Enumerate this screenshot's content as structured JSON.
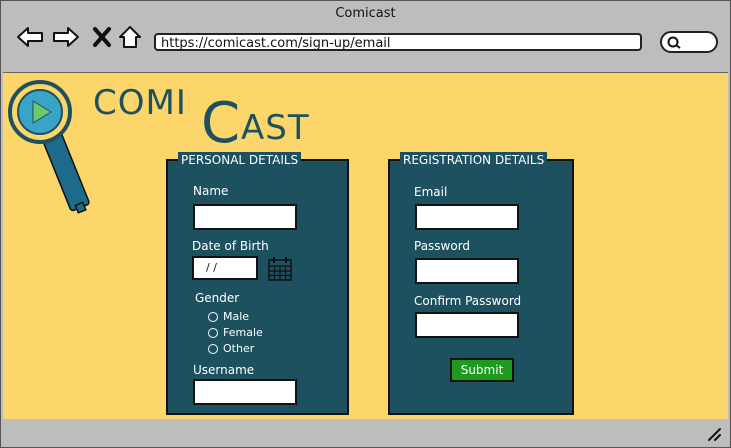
{
  "window": {
    "title": "Comicast"
  },
  "toolbar": {
    "back_icon": "arrow-left-icon",
    "forward_icon": "arrow-right-icon",
    "close_icon": "x-icon",
    "home_icon": "home-icon",
    "url": "https://comicast.com/sign-up/email",
    "search_icon": "search-icon"
  },
  "logo": {
    "part1": "COMI",
    "part2": "C",
    "part3": "AST"
  },
  "personal": {
    "title": "PERSONAL DETAILS",
    "name_label": "Name",
    "dob_label": "Date of Birth",
    "dob_value": "/ /",
    "gender_label": "Gender",
    "gender_options": [
      "Male",
      "Female",
      "Other"
    ],
    "username_label": "Username"
  },
  "registration": {
    "title": "REGISTRATION DETAILS",
    "email_label": "Email",
    "password_label": "Password",
    "confirm_label": "Confirm Password",
    "submit_label": "Submit"
  },
  "colors": {
    "accent": "#1d5160",
    "background": "#fcd66a",
    "chrome": "#bdbdbd",
    "submit": "#1e9b1e"
  }
}
